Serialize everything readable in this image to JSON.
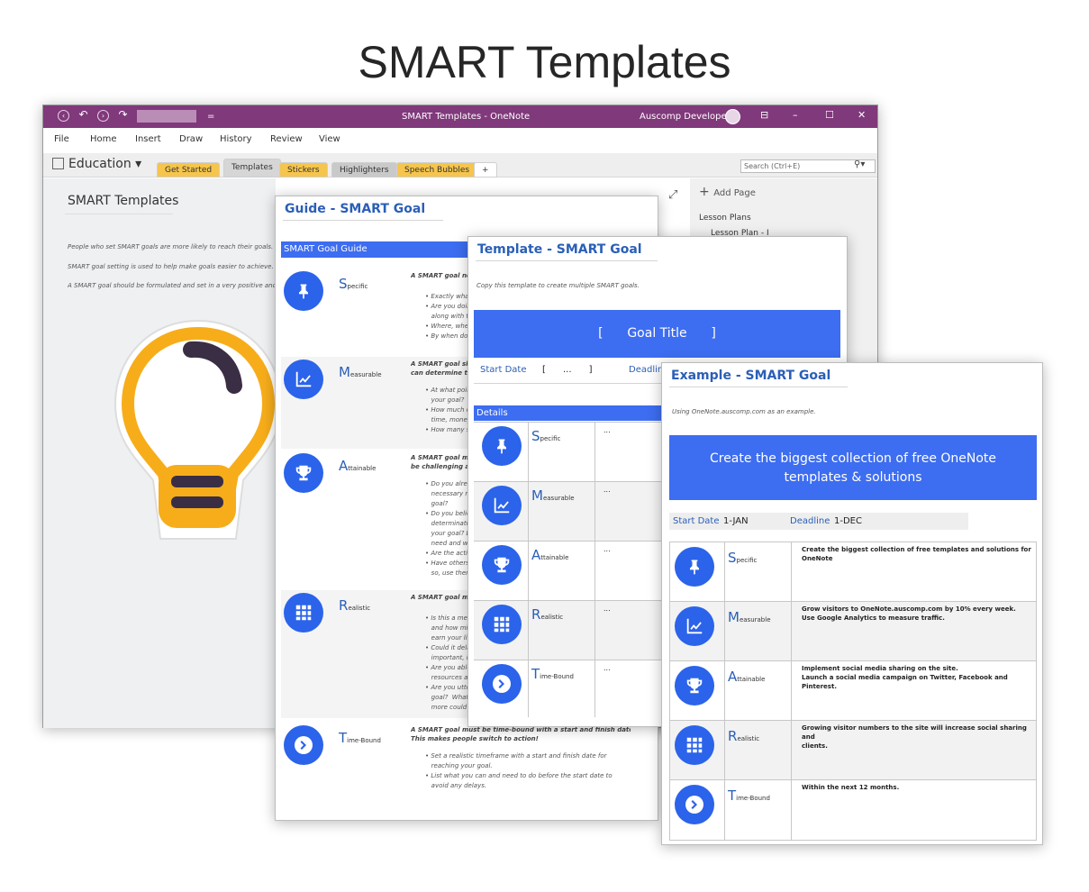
{
  "page_title": "SMART Templates",
  "onenote": {
    "window_title": "SMART Templates  -  OneNote",
    "user_name": "Auscomp Developer",
    "menu": [
      "File",
      "Home",
      "Insert",
      "Draw",
      "History",
      "Review",
      "View"
    ],
    "notebook": "Education ▾",
    "tabs": [
      {
        "label": "Get Started",
        "color": "#f5c54d"
      },
      {
        "label": "Templates",
        "color": "#d6d6d6"
      },
      {
        "label": "Stickers",
        "color": "#f5c54d"
      },
      {
        "label": "Highlighters",
        "color": "#c9c9c9"
      },
      {
        "label": "Speech Bubbles",
        "color": "#f5c54d"
      },
      {
        "label": "+",
        "color": "#ffffff"
      }
    ],
    "search_placeholder": "Search (Ctrl+E)",
    "page_heading": "SMART Templates",
    "intro_lines": [
      "People who set SMART goals are more likely to reach their goals.",
      "SMART goal setting is used to help make goals easier to achieve.",
      "A SMART goal should be formulated and set in a very positive and"
    ],
    "add_page": "Add Page",
    "page_list": [
      "Lesson Plans",
      "Lesson Plan - I"
    ]
  },
  "guide": {
    "title": "Guide - SMART Goal",
    "bar": "SMART Goal Guide",
    "rows": [
      {
        "letter": "S",
        "rest": "pecific",
        "icon": "pushpin-icon",
        "heading": "A SMART goal nee",
        "bullets": [
          "• Exactly what",
          "• Are you doin",
          "   along with th",
          "• Where, wher",
          "• By when do y"
        ]
      },
      {
        "letter": "M",
        "rest": "easurable",
        "icon": "trend-chart-icon",
        "heading": "A SMART goal sho",
        "heading2": "can determine the",
        "bullets": [
          "• At what poin",
          "   your goal?",
          "• How much c",
          "   time, money",
          "• How many st"
        ]
      },
      {
        "letter": "A",
        "rest": "ttainable",
        "icon": "trophy-icon",
        "heading": "A SMART goal mus",
        "heading2": "be challenging and",
        "bullets": [
          "• Do you alrea",
          "   necessary re",
          "   goal?",
          "• Do you belie",
          "   determinatio",
          "   your goal? D",
          "   need and wit",
          "• Are the actio",
          "• Have others",
          "   so, use them"
        ]
      },
      {
        "letter": "R",
        "rest": "ealistic",
        "icon": "grid-icon",
        "heading": "A SMART goal mu",
        "bullets": [
          "• Is this a mea",
          "   and how mig",
          "   earn your livi",
          "• Could it delay",
          "   important, in",
          "• Are you able",
          "   resources an",
          "• Are you utter",
          "   goal?  What",
          "   more could y"
        ]
      },
      {
        "letter": "T",
        "rest": "ime-Bound",
        "icon": "chevron-right-icon",
        "heading": "A SMART goal must be time-bound with a start and finish date.",
        "heading2": "This makes people switch to action!",
        "bullets": [
          "• Set a realistic timeframe with a start and finish date for",
          "   reaching your goal.",
          "• List what you can and need to do before the start date to",
          "   avoid any delays."
        ]
      }
    ]
  },
  "template": {
    "title": "Template - SMART Goal",
    "note": "Copy this template to create multiple SMART goals.",
    "goal_title": "[      Goal Title      ]",
    "start_label": "Start Date",
    "start_value": "[      ...      ]",
    "deadline_label": "Deadlin",
    "details": "Details",
    "rows": [
      {
        "letter": "S",
        "rest": "pecific",
        "icon": "pushpin-icon",
        "value": "..."
      },
      {
        "letter": "M",
        "rest": "easurable",
        "icon": "trend-chart-icon",
        "value": "..."
      },
      {
        "letter": "A",
        "rest": "ttainable",
        "icon": "trophy-icon",
        "value": "..."
      },
      {
        "letter": "R",
        "rest": "ealistic",
        "icon": "grid-icon",
        "value": "..."
      },
      {
        "letter": "T",
        "rest": "ime-Bound",
        "icon": "chevron-right-icon",
        "value": "..."
      }
    ]
  },
  "example": {
    "title": "Example - SMART Goal",
    "note": "Using OneNote.auscomp.com as an example.",
    "goal_line1": "Create the biggest collection of free OneNote",
    "goal_line2": "templates & solutions",
    "start_label": "Start Date",
    "start_value": "1-JAN",
    "deadline_label": "Deadline",
    "deadline_value": "1-DEC",
    "rows": [
      {
        "letter": "S",
        "rest": "pecific",
        "icon": "pushpin-icon",
        "lines": [
          "Create the biggest collection of free templates and solutions for",
          "OneNote"
        ]
      },
      {
        "letter": "M",
        "rest": "easurable",
        "icon": "trend-chart-icon",
        "lines": [
          "Grow visitors to OneNote.auscomp.com by 10% every week.",
          "Use Google Analytics to measure traffic."
        ]
      },
      {
        "letter": "A",
        "rest": "ttainable",
        "icon": "trophy-icon",
        "lines": [
          "Implement social media sharing on the site.",
          "Launch a social media campaign on Twitter, Facebook and",
          "Pinterest."
        ]
      },
      {
        "letter": "R",
        "rest": "ealistic",
        "icon": "grid-icon",
        "lines": [
          "Growing visitor numbers to the site will increase social sharing and",
          "clients."
        ]
      },
      {
        "letter": "T",
        "rest": "ime-Bound",
        "icon": "chevron-right-icon",
        "lines": [
          "Within the next 12 months."
        ]
      }
    ]
  }
}
